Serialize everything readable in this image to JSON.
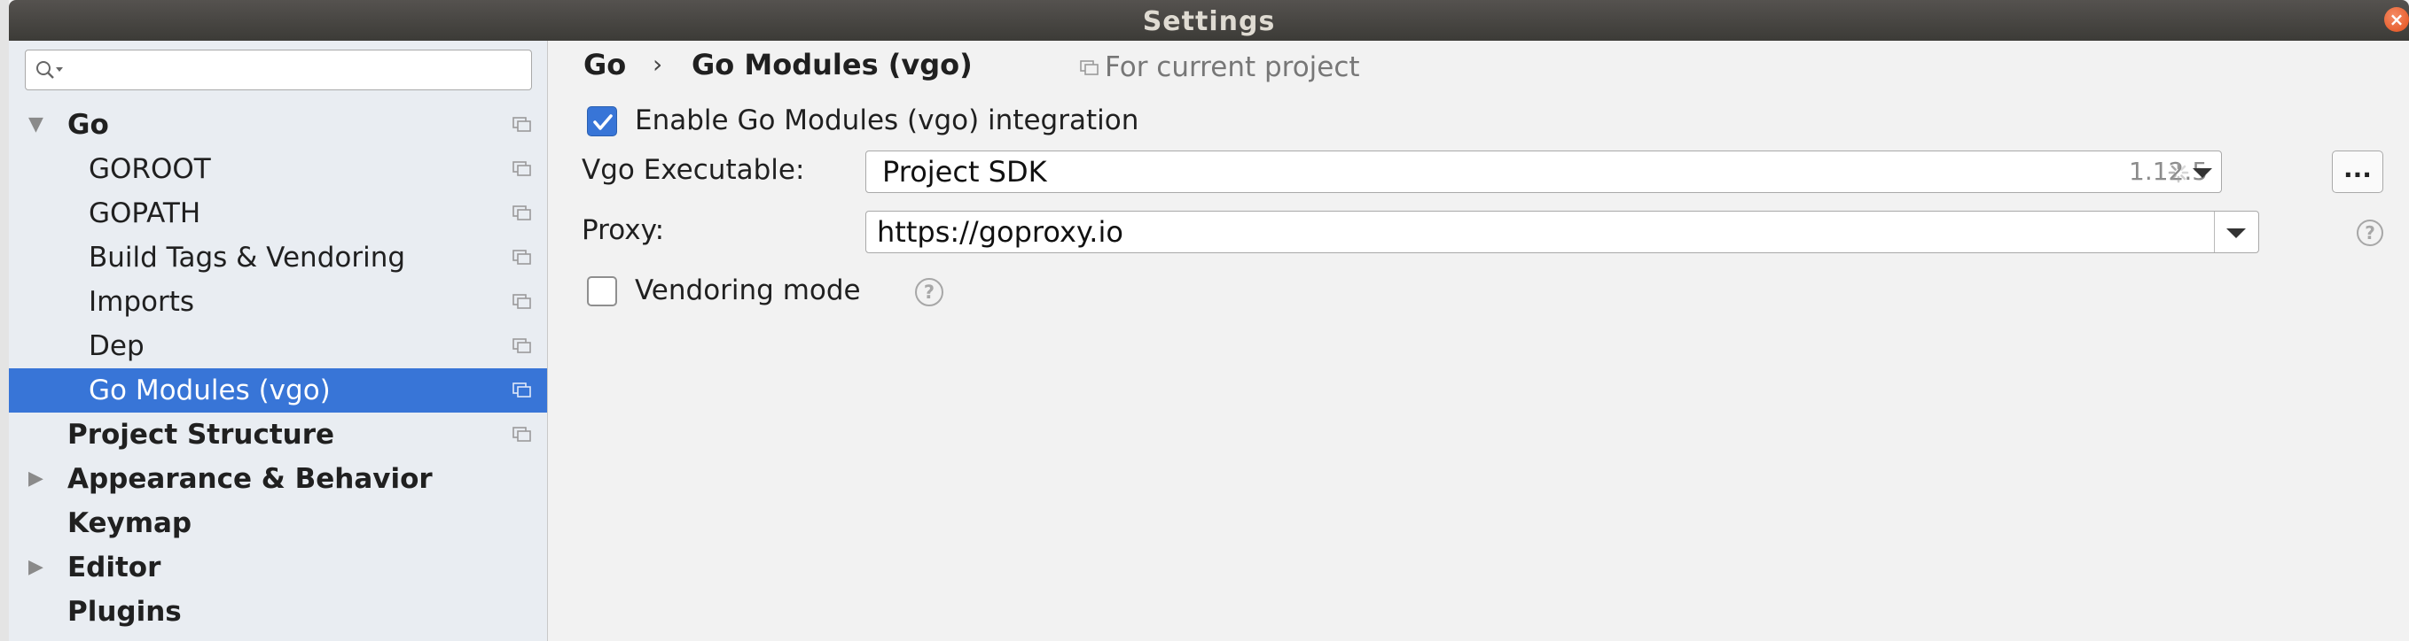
{
  "window": {
    "title": "Settings"
  },
  "sidebar": {
    "search_placeholder": "",
    "items": [
      {
        "label": "Go",
        "bold": true,
        "expanded": true
      },
      {
        "label": "GOROOT"
      },
      {
        "label": "GOPATH"
      },
      {
        "label": "Build Tags & Vendoring"
      },
      {
        "label": "Imports"
      },
      {
        "label": "Dep"
      },
      {
        "label": "Go Modules (vgo)",
        "selected": true
      },
      {
        "label": "Project Structure",
        "bold": true
      },
      {
        "label": "Appearance & Behavior",
        "bold": true,
        "expanded": false
      },
      {
        "label": "Keymap",
        "bold": true
      },
      {
        "label": "Editor",
        "bold": true,
        "expanded": false
      },
      {
        "label": "Plugins",
        "bold": true
      }
    ]
  },
  "breadcrumb": {
    "root": "Go",
    "separator": "›",
    "current": "Go Modules (vgo)",
    "scope_label": "For current project"
  },
  "form": {
    "enable_label": "Enable Go Modules (vgo) integration",
    "enable_checked": true,
    "executable_label": "Vgo Executable:",
    "executable_value": "Project SDK",
    "executable_version": "1.12.5",
    "browse_label": "...",
    "proxy_label": "Proxy:",
    "proxy_value": "https://goproxy.io",
    "vendoring_label": "Vendoring mode",
    "vendoring_checked": false,
    "help_glyph": "?"
  },
  "colors": {
    "accent": "#3875d7",
    "titlebar": "#3c3b37",
    "close": "#e2501c"
  },
  "icons": [
    "search-icon",
    "copy-icon",
    "expand-arrow-icon",
    "collapse-arrow-icon",
    "checkmark-icon",
    "dropdown-caret-icon",
    "spinner-icon",
    "help-icon",
    "close-icon"
  ]
}
